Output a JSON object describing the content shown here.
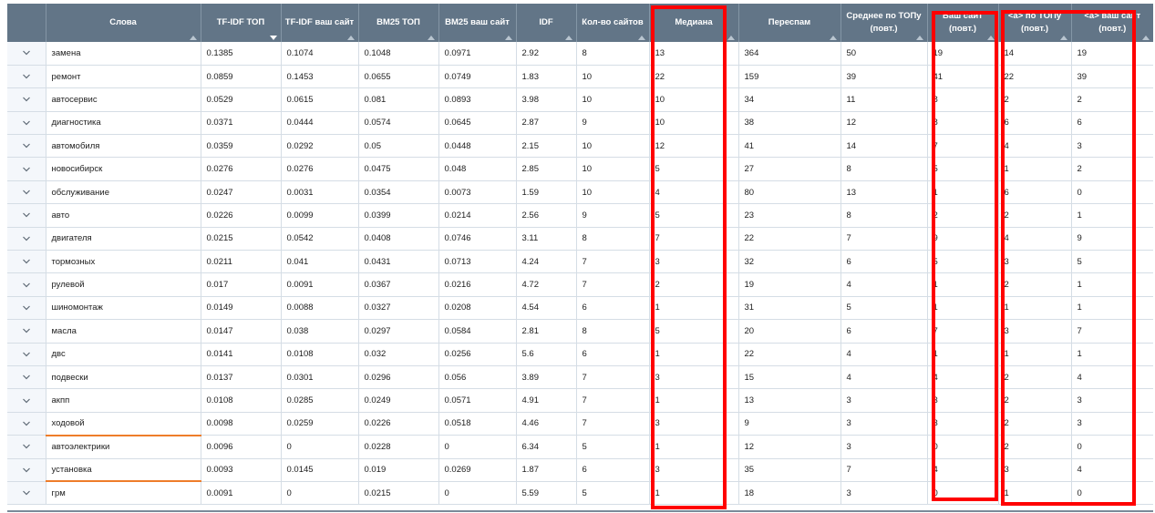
{
  "table": {
    "columns": [
      {
        "label": "",
        "name": "expand-column-header",
        "sort": "none"
      },
      {
        "label": "Слова",
        "name": "column-words",
        "sort": "asc"
      },
      {
        "label": "TF-IDF ТОП",
        "name": "column-tfidf-top",
        "sort": "desc"
      },
      {
        "label": "TF-IDF ваш сайт",
        "name": "column-tfidf-site",
        "sort": "asc"
      },
      {
        "label": "BM25 ТОП",
        "name": "column-bm25-top",
        "sort": "asc"
      },
      {
        "label": "BM25 ваш сайт",
        "name": "column-bm25-site",
        "sort": "asc"
      },
      {
        "label": "IDF",
        "name": "column-idf",
        "sort": "asc"
      },
      {
        "label": "Кол-во сайтов",
        "name": "column-sites-count",
        "sort": "asc"
      },
      {
        "label": "Медиана",
        "name": "column-median",
        "sort": "asc"
      },
      {
        "label": "Переспам",
        "name": "column-overspam",
        "sort": "asc"
      },
      {
        "label": "Среднее по ТОПу (повт.)",
        "name": "column-avg-top",
        "sort": "asc"
      },
      {
        "label": "Ваш сайт (повт.)",
        "name": "column-your-site",
        "sort": "asc"
      },
      {
        "label": "<a> по ТОПу (повт.)",
        "name": "column-a-top",
        "sort": "asc"
      },
      {
        "label": "<a> ваш сайт (повт.)",
        "name": "column-a-site",
        "sort": "asc"
      }
    ],
    "rows": [
      [
        "замена",
        "0.1385",
        "0.1074",
        "0.1048",
        "0.0971",
        "2.92",
        "8",
        "13",
        "364",
        "50",
        "19",
        "14",
        "19"
      ],
      [
        "ремонт",
        "0.0859",
        "0.1453",
        "0.0655",
        "0.0749",
        "1.83",
        "10",
        "22",
        "159",
        "39",
        "41",
        "22",
        "39"
      ],
      [
        "автосервис",
        "0.0529",
        "0.0615",
        "0.081",
        "0.0893",
        "3.98",
        "10",
        "10",
        "34",
        "11",
        "8",
        "2",
        "2"
      ],
      [
        "диагностика",
        "0.0371",
        "0.0444",
        "0.0574",
        "0.0645",
        "2.87",
        "9",
        "10",
        "38",
        "12",
        "8",
        "6",
        "6"
      ],
      [
        "автомобиля",
        "0.0359",
        "0.0292",
        "0.05",
        "0.0448",
        "2.15",
        "10",
        "12",
        "41",
        "14",
        "7",
        "4",
        "3"
      ],
      [
        "новосибирск",
        "0.0276",
        "0.0276",
        "0.0475",
        "0.048",
        "2.85",
        "10",
        "5",
        "27",
        "8",
        "5",
        "1",
        "2"
      ],
      [
        "обслуживание",
        "0.0247",
        "0.0031",
        "0.0354",
        "0.0073",
        "1.59",
        "10",
        "4",
        "80",
        "13",
        "1",
        "6",
        "0"
      ],
      [
        "авто",
        "0.0226",
        "0.0099",
        "0.0399",
        "0.0214",
        "2.56",
        "9",
        "5",
        "23",
        "8",
        "2",
        "2",
        "1"
      ],
      [
        "двигателя",
        "0.0215",
        "0.0542",
        "0.0408",
        "0.0746",
        "3.11",
        "8",
        "7",
        "22",
        "7",
        "9",
        "4",
        "9"
      ],
      [
        "тормозных",
        "0.0211",
        "0.041",
        "0.0431",
        "0.0713",
        "4.24",
        "7",
        "3",
        "32",
        "6",
        "5",
        "3",
        "5"
      ],
      [
        "рулевой",
        "0.017",
        "0.0091",
        "0.0367",
        "0.0216",
        "4.72",
        "7",
        "2",
        "19",
        "4",
        "1",
        "2",
        "1"
      ],
      [
        "шиномонтаж",
        "0.0149",
        "0.0088",
        "0.0327",
        "0.0208",
        "4.54",
        "6",
        "1",
        "31",
        "5",
        "1",
        "1",
        "1"
      ],
      [
        "масла",
        "0.0147",
        "0.038",
        "0.0297",
        "0.0584",
        "2.81",
        "8",
        "5",
        "20",
        "6",
        "7",
        "3",
        "7"
      ],
      [
        "двс",
        "0.0141",
        "0.0108",
        "0.032",
        "0.0256",
        "5.6",
        "6",
        "1",
        "22",
        "4",
        "1",
        "1",
        "1"
      ],
      [
        "подвески",
        "0.0137",
        "0.0301",
        "0.0296",
        "0.056",
        "3.89",
        "7",
        "3",
        "15",
        "4",
        "4",
        "2",
        "4"
      ],
      [
        "акпп",
        "0.0108",
        "0.0285",
        "0.0249",
        "0.0571",
        "4.91",
        "7",
        "1",
        "13",
        "3",
        "3",
        "2",
        "3"
      ],
      [
        "ходовой",
        "0.0098",
        "0.0259",
        "0.0226",
        "0.0518",
        "4.46",
        "7",
        "3",
        "9",
        "3",
        "3",
        "2",
        "3"
      ],
      [
        "автоэлектрики",
        "0.0096",
        "0",
        "0.0228",
        "0",
        "6.34",
        "5",
        "1",
        "12",
        "3",
        "0",
        "2",
        "0"
      ],
      [
        "установка",
        "0.0093",
        "0.0145",
        "0.019",
        "0.0269",
        "1.87",
        "6",
        "3",
        "35",
        "7",
        "4",
        "3",
        "4"
      ],
      [
        "грм",
        "0.0091",
        "0",
        "0.0215",
        "0",
        "5.59",
        "5",
        "1",
        "18",
        "3",
        "0",
        "1",
        "0"
      ]
    ],
    "orange_underline_rows": [
      16,
      18
    ]
  },
  "colors": {
    "header_bg": "#627587",
    "highlight": "#ff0000",
    "underline": "#ee7d2a"
  },
  "icons": {
    "row_expand": "chevron-down-icon"
  }
}
